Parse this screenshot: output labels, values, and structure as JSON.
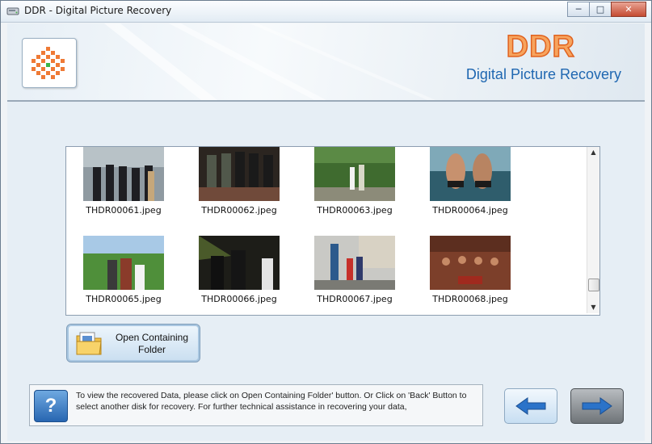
{
  "window": {
    "title": "DDR - Digital Picture Recovery",
    "controls": [
      "minimize",
      "maximize",
      "close"
    ]
  },
  "banner": {
    "brand": "DDR",
    "subtitle": "Digital Picture Recovery"
  },
  "gallery": {
    "items": [
      {
        "name": "THDR00061.jpeg",
        "scene": "group-graduation"
      },
      {
        "name": "THDR00062.jpeg",
        "scene": "group-dark"
      },
      {
        "name": "THDR00063.jpeg",
        "scene": "couple-forest"
      },
      {
        "name": "THDR00064.jpeg",
        "scene": "friends-beach"
      },
      {
        "name": "THDR00065.jpeg",
        "scene": "family-field"
      },
      {
        "name": "THDR00066.jpeg",
        "scene": "group-palm"
      },
      {
        "name": "THDR00067.jpeg",
        "scene": "family-street"
      },
      {
        "name": "THDR00068.jpeg",
        "scene": "group-indoor"
      }
    ]
  },
  "actions": {
    "open_folder_line1": "Open Containing",
    "open_folder_line2": "Folder"
  },
  "help": {
    "icon_label": "?",
    "text": "To view the recovered Data, please click on Open Containing Folder' button. Or Click on 'Back' Button to select another disk for recovery. For further technical assistance in recovering your data,"
  },
  "navigation": {
    "back_icon": "arrow-left-icon",
    "next_icon": "arrow-right-icon"
  },
  "colors": {
    "brand_orange": "#f7a45e",
    "brand_blue": "#1f67b1",
    "nav_arrow_blue": "#2b73c9"
  }
}
